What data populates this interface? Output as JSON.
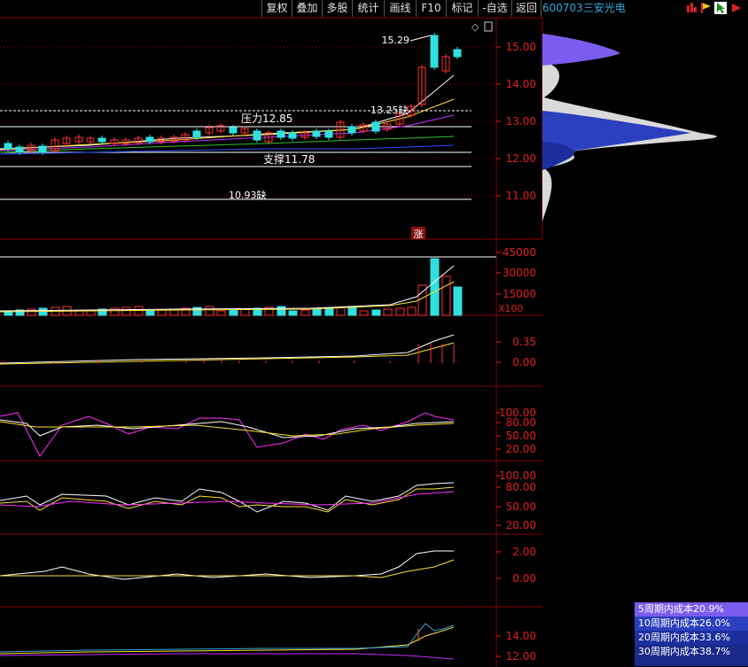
{
  "toolbar": {
    "buttons": [
      "复权",
      "叠加",
      "多股",
      "统计",
      "画线",
      "F10",
      "标记",
      "-自选",
      "返回"
    ]
  },
  "stock": {
    "code": "600703",
    "name": "三安光电"
  },
  "main_chart": {
    "price_axis": [
      "15.00",
      "14.00",
      "13.00",
      "12.00",
      "11.00"
    ],
    "labels": {
      "high": "15.29",
      "gap_up": "13.25缺",
      "resistance": "压力12.85",
      "support": "支撑11.78",
      "gap_down": "10.93缺",
      "limit_up": "涨"
    }
  },
  "volume_panel": {
    "axis": [
      "45000",
      "30000",
      "15000"
    ],
    "unit": "X100"
  },
  "panel3": {
    "axis": [
      "0.35",
      "0.00"
    ]
  },
  "panel4": {
    "axis": [
      "100.00",
      "80.00",
      "50.00",
      "20.00"
    ]
  },
  "panel5": {
    "axis": [
      "100.00",
      "80.00",
      "50.00",
      "20.00"
    ]
  },
  "panel6": {
    "axis": [
      "2.00",
      "0.00"
    ]
  },
  "panel7": {
    "axis": [
      "14.00",
      "12.00"
    ]
  },
  "cost_legend": [
    {
      "label": "5周期内成本20.9%",
      "color": "#7b5cf0"
    },
    {
      "label": "10周期内成本26.0%",
      "color": "#2b3fbf"
    },
    {
      "label": "20周期内成本33.6%",
      "color": "#1b2f9f"
    },
    {
      "label": "30周期内成本38.7%",
      "color": "#1a2a8a"
    },
    {
      "label": "",
      "color": "#1a2a8a"
    }
  ],
  "colors": {
    "up": "#ff3030",
    "down": "#30e0e0",
    "grid": "#8b0000",
    "axis_text": "#e02020"
  }
}
